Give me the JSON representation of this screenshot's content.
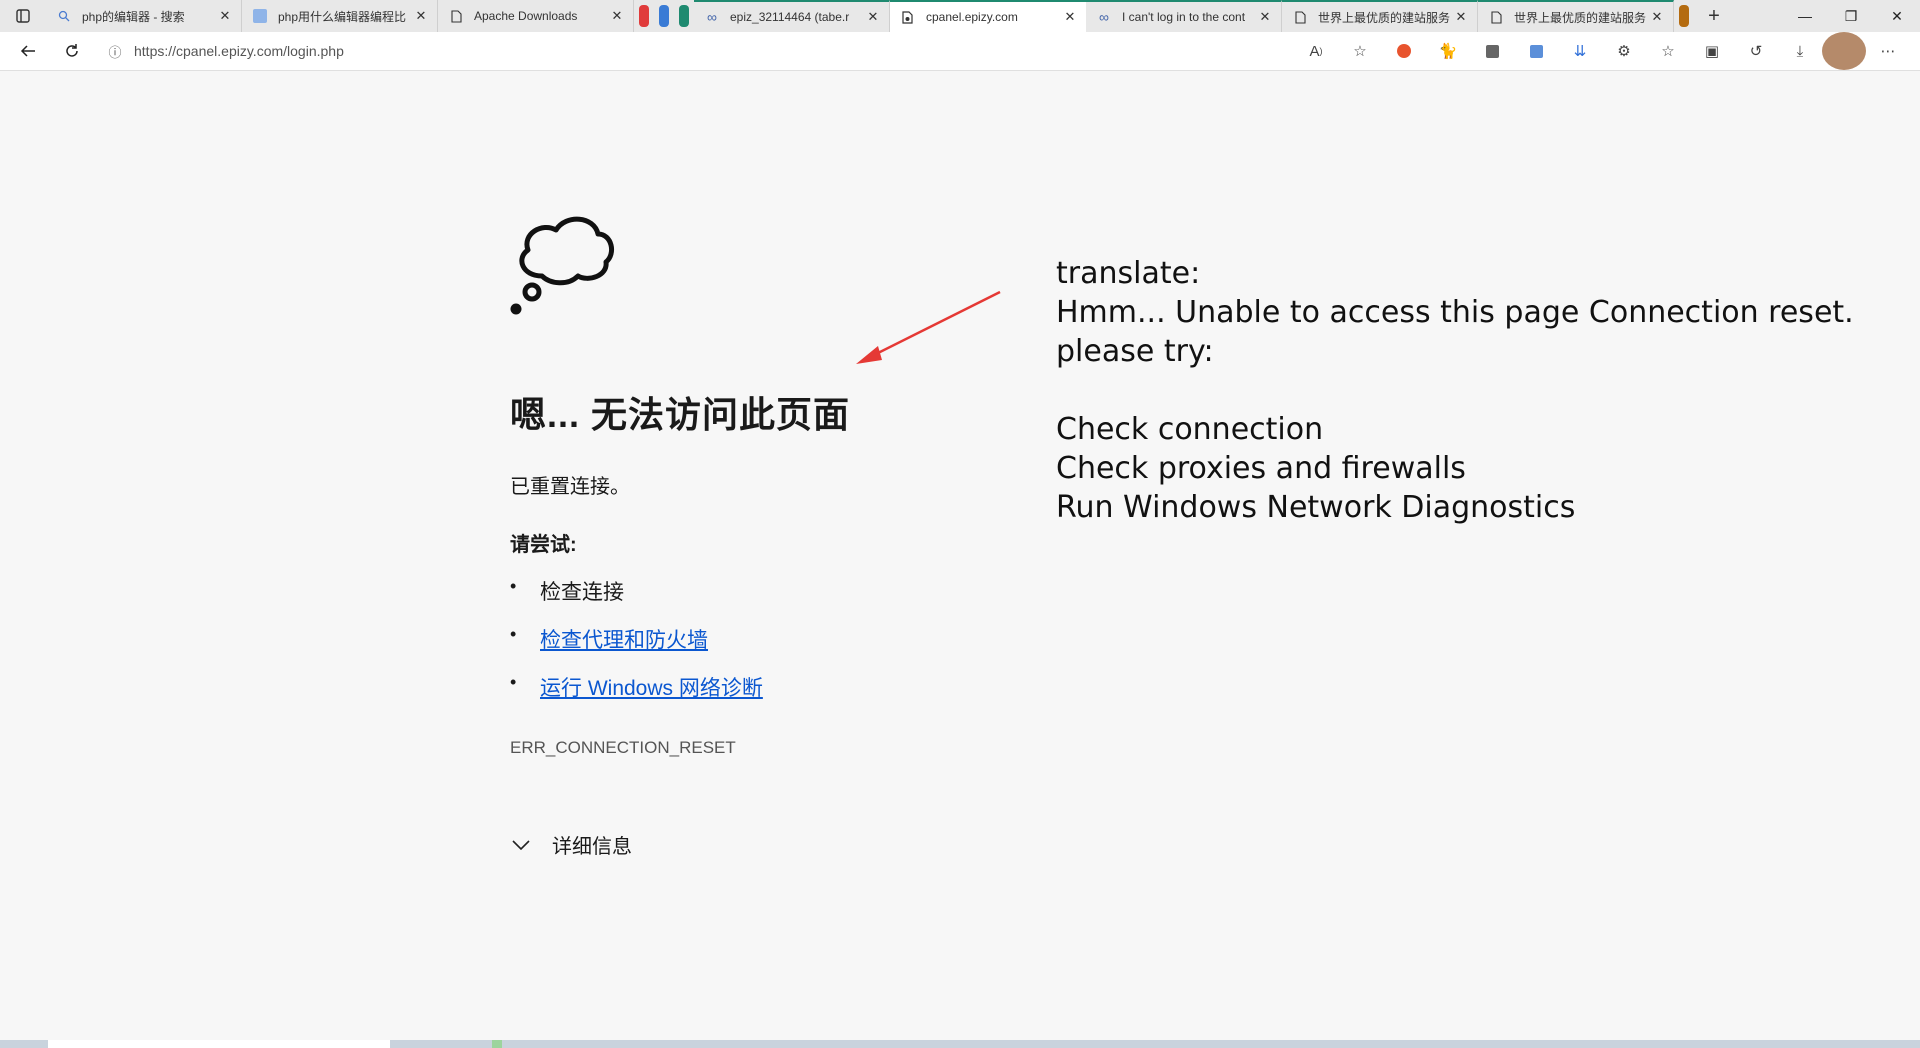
{
  "tabs": [
    {
      "title": "php的编辑器 - 搜索",
      "icon": "search-icon"
    },
    {
      "title": "php用什么编辑器编程比",
      "icon": "site-icon"
    },
    {
      "title": "Apache Downloads",
      "icon": "page-icon"
    },
    {
      "title": "epiz_32114464 (tabe.r",
      "icon": "infinity-icon"
    },
    {
      "title": "cpanel.epizy.com",
      "icon": "page-icon",
      "active": true
    },
    {
      "title": "I can't log in to the cont",
      "icon": "infinity-icon"
    },
    {
      "title": "世界上最优质的建站服务",
      "icon": "page-icon"
    },
    {
      "title": "世界上最优质的建站服务",
      "icon": "page-icon"
    }
  ],
  "tab_group_colors": [
    "#e03b3b",
    "#3a7bd5",
    "#1f8a70",
    "#b46b10"
  ],
  "address_bar": {
    "url": "https://cpanel.epizy.com/login.php"
  },
  "error_page": {
    "title": "嗯... 无法访问此页面",
    "description": "已重置连接。",
    "try_heading": "请尝试:",
    "tips": [
      "检查连接",
      "检查代理和防火墙",
      "运行 Windows 网络诊断"
    ],
    "error_code": "ERR_CONNECTION_RESET",
    "details_label": "详细信息"
  },
  "annotation": {
    "arrow_color": "#e53935",
    "lines": [
      "translate:",
      "Hmm... Unable to access this page Connection reset.",
      "please try:",
      "",
      "Check connection",
      "Check proxies and firewalls",
      "Run Windows Network Diagnostics"
    ]
  },
  "colors": {
    "link": "#0b57d0",
    "active_tab_accent": "#1f8a70"
  }
}
